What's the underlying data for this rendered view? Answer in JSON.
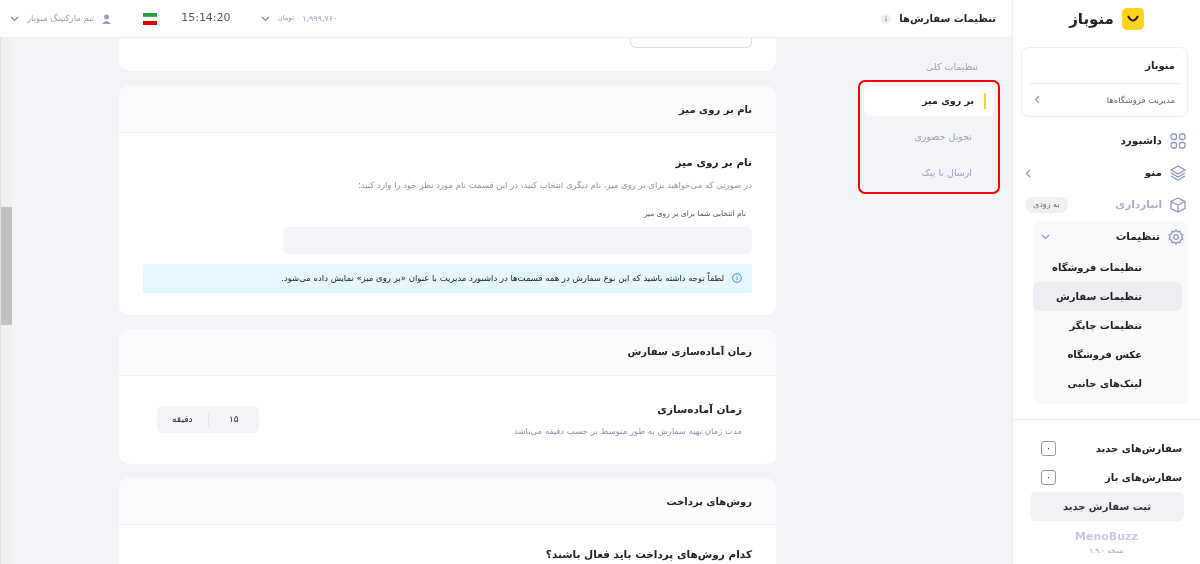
{
  "sidebar": {
    "logo_text": "منوباز",
    "store_card": {
      "title": "منوباز",
      "link": "مدیریت فروشگاه‌ها"
    },
    "nav": [
      {
        "label": "داشبورد",
        "expanded": false,
        "disabled": false
      },
      {
        "label": "منو",
        "expanded": false,
        "disabled": false,
        "has_children": true
      },
      {
        "label": "انبارداری",
        "expanded": false,
        "disabled": true,
        "badge": "به زودی"
      },
      {
        "label": "تنظیمات",
        "expanded": true,
        "disabled": false,
        "has_children": true,
        "children": [
          {
            "label": "تنظیمات فروشگاه",
            "selected": false
          },
          {
            "label": "تنظیمات سفارش",
            "selected": true
          },
          {
            "label": "تنظیمات چاپگر",
            "selected": false
          },
          {
            "label": "عکس فروشگاه",
            "selected": false
          },
          {
            "label": "لینک‌های جانبی",
            "selected": false
          }
        ]
      }
    ],
    "order_counts": [
      {
        "label": "سفارش‌های جدید",
        "count": "۰"
      },
      {
        "label": "سفارش‌های باز",
        "count": "۰"
      }
    ],
    "new_order_button": "ثبت سفارش جدید",
    "brand": "MenoBuzz",
    "version": "نسخه ۱.۹.۰"
  },
  "topbar": {
    "page_title": "تنظیمات سفارش‌ها",
    "balance": "۱,۹۹۹,۷۶۰",
    "currency": "تومان",
    "time": "15:14:20",
    "user": "تیم مارکتینگ منوباز"
  },
  "subnav": {
    "heading": "تنظیمات کلی",
    "items": [
      {
        "label": "بر روی میز",
        "selected": true
      },
      {
        "label": "تحویل حضوری",
        "selected": false
      },
      {
        "label": "ارسال با پیک",
        "selected": false
      }
    ]
  },
  "cards": [
    {
      "kind": "name",
      "title": "نام بر روی میز",
      "field_title": "نام بر روی میز",
      "description": "در صورتی که می‌خواهید برای بر روی میز، نام دیگری انتخاب کنید، در این قسمت نام مورد نظر خود را وارد کنید:",
      "field_label": "نام انتخابی شما برای بر روی میز",
      "note": "لطفاً توجه داشته باشید که این نوع سفارش در همه قسمت‌ها در داشبورد مدیریت با عنوان «بر روی میز» نمایش داده می‌شود."
    },
    {
      "kind": "prep",
      "title": "زمان آماده‌سازی سفارش",
      "field_title": "زمان آماده‌سازی",
      "description": "مدت زمان تهیه سفارش به طور متوسط بر حسب دقیقه می‌باشد",
      "value": "۱۵",
      "unit": "دقیقه"
    },
    {
      "kind": "payment",
      "title": "روش‌های پرداخت",
      "question": "کدام روش‌های پرداخت باید فعال باشند؟"
    }
  ]
}
